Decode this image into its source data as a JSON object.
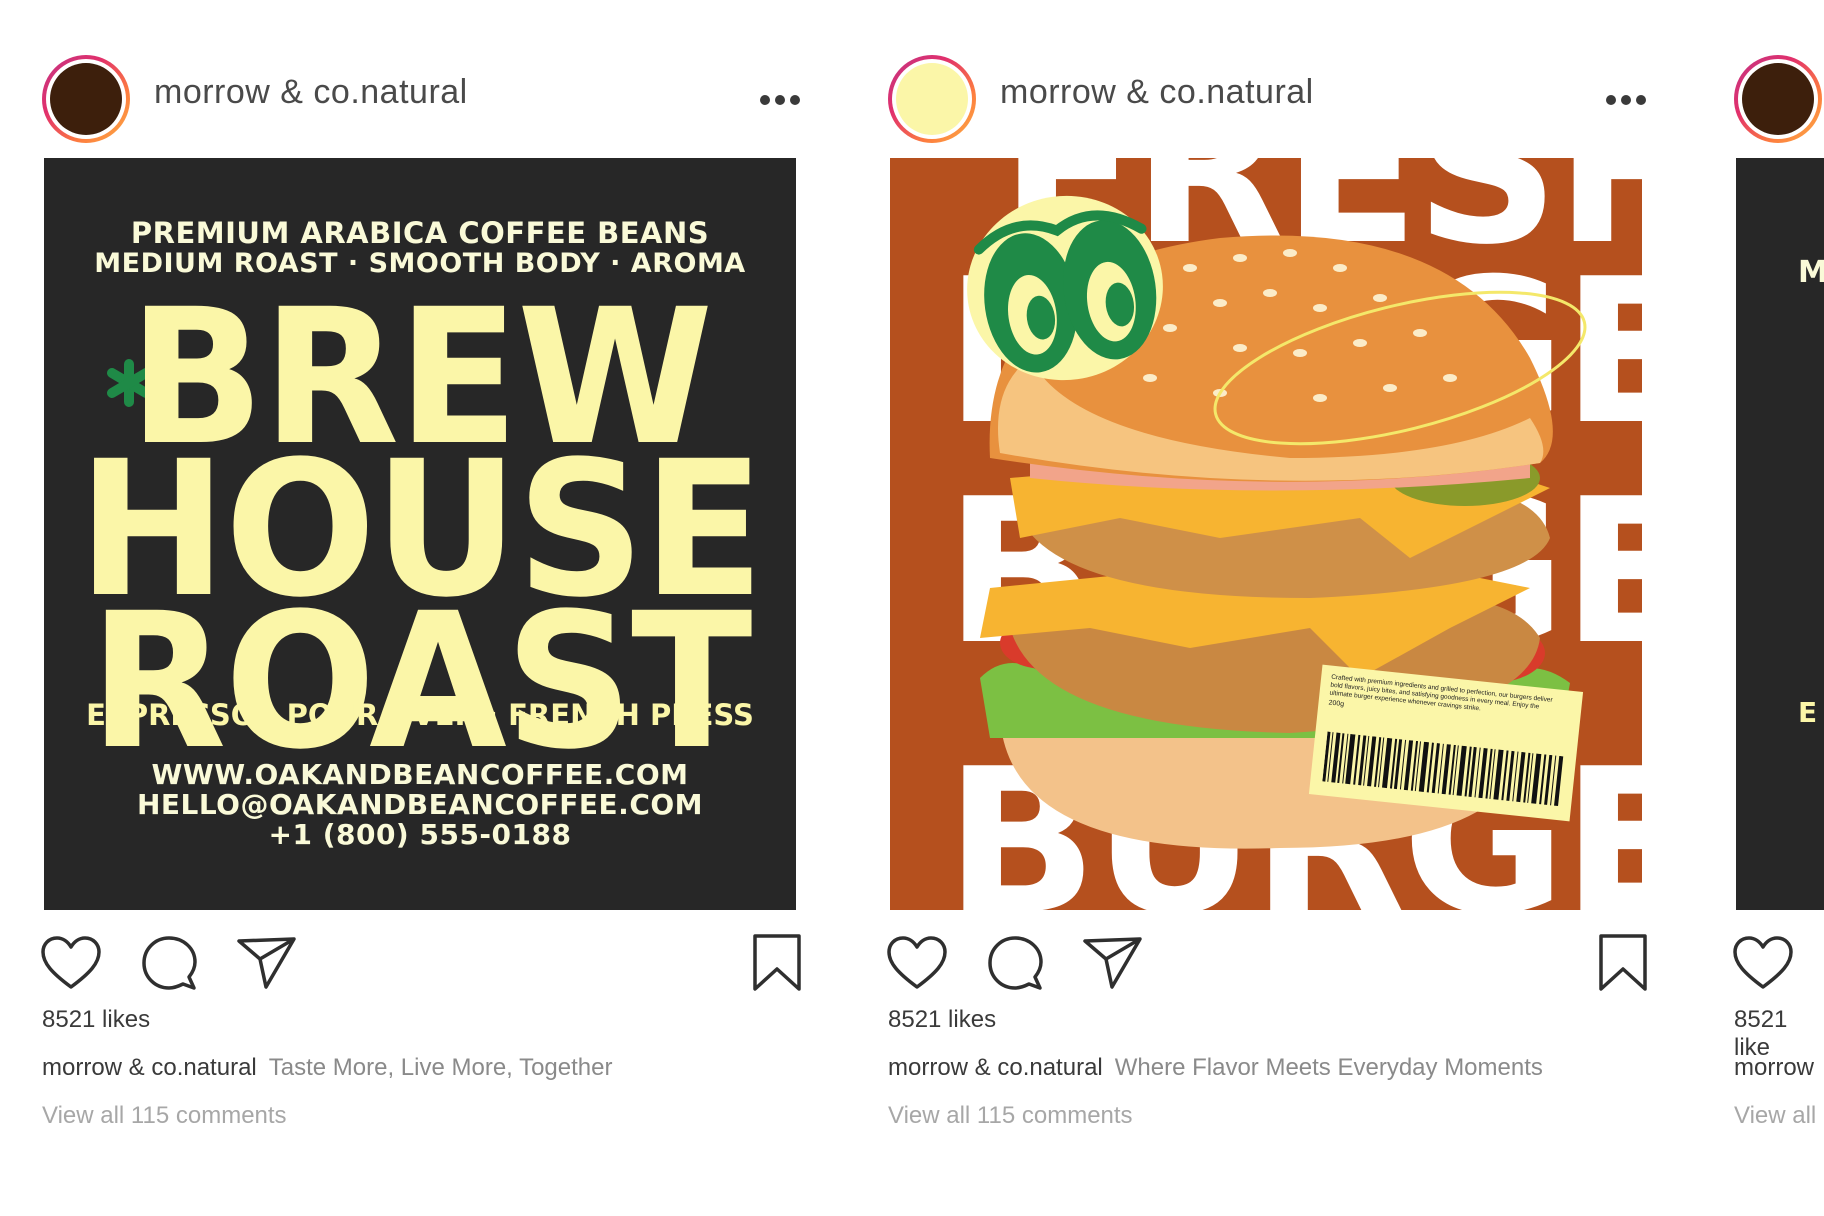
{
  "colors": {
    "coffee_bg": "#272727",
    "coffee_yellow": "#fbf6a8",
    "burger_bg": "#b5501e",
    "accent_green": "#1f8a47",
    "avatar_dark": "#3d1f0c",
    "avatar_light": "#fbf6a8"
  },
  "posts": [
    {
      "username": "morrow & co.natural",
      "avatar_color": "#3d1f0c",
      "media": {
        "line1": "PREMIUM ARABICA COFFEE BEANS",
        "line2": "MEDIUM ROAST · SMOOTH BODY · AROMA",
        "title1": "BREW",
        "title2": "HOUSE",
        "title3": "ROAST",
        "methods": "ESPRESSO · POUR OVER · FRENCH PRESS",
        "website": "WWW.OAKANDBEANCOFFEE.COM",
        "email": "HELLO@OAKANDBEANCOFFEE.COM",
        "phone": "+1 (800) 555-0188"
      },
      "likes": "8521 likes",
      "caption_user": "morrow & co.natural",
      "caption": "Taste More, Live More, Together",
      "comments": "View all 115 comments"
    },
    {
      "username": "morrow & co.natural",
      "avatar_color": "#fbf6a8",
      "media": {
        "bg_word_top": "FRESH",
        "bg_word_2": "BURGER",
        "bg_word_3": "BURGER",
        "bg_word_bottom": "BURGER",
        "label_text": "Crafted with premium ingredients and grilled to perfection, our burgers deliver bold flavors, juicy bites, and satisfying goodness in every meal. Enjoy the ultimate burger experience whenever cravings strike.",
        "label_weight": "200g"
      },
      "likes": "8521 likes",
      "caption_user": "morrow & co.natural",
      "caption": "Where Flavor Meets Everyday Moments",
      "comments": "View all 115 comments"
    },
    {
      "avatar_color": "#3d1f0c",
      "media": {
        "partial_text": "M",
        "partial_text_2": "E"
      },
      "likes": "8521 like",
      "caption_user": "morrow",
      "comments": "View all"
    }
  ]
}
